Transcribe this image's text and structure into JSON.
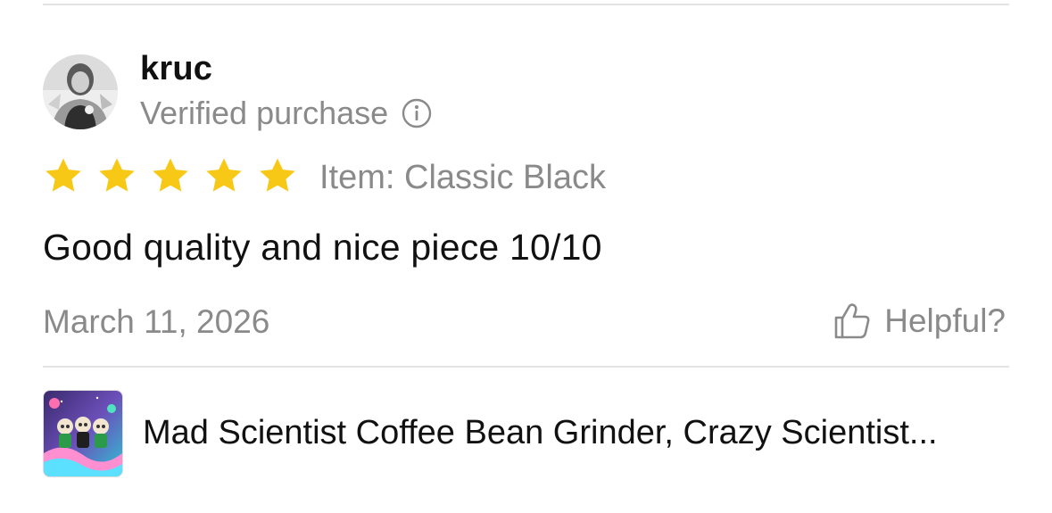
{
  "review": {
    "reviewer_name": "kruc",
    "verified_label": "Verified purchase",
    "rating": 5,
    "max_rating": 5,
    "variant_label": "Item: Classic Black",
    "body": "Good quality and nice piece 10/10",
    "date": "March 11, 2026",
    "helpful_label": "Helpful?"
  },
  "product": {
    "title": "Mad Scientist Coffee Bean Grinder, Crazy Scientist..."
  },
  "icons": {
    "avatar": "avatar",
    "info": "info-icon",
    "star": "star-icon",
    "thumb": "thumbs-up-icon"
  },
  "colors": {
    "star": "#F7C815",
    "muted_text": "#8A8A8A",
    "primary_text": "#111111",
    "divider": "#E3E3E3"
  }
}
